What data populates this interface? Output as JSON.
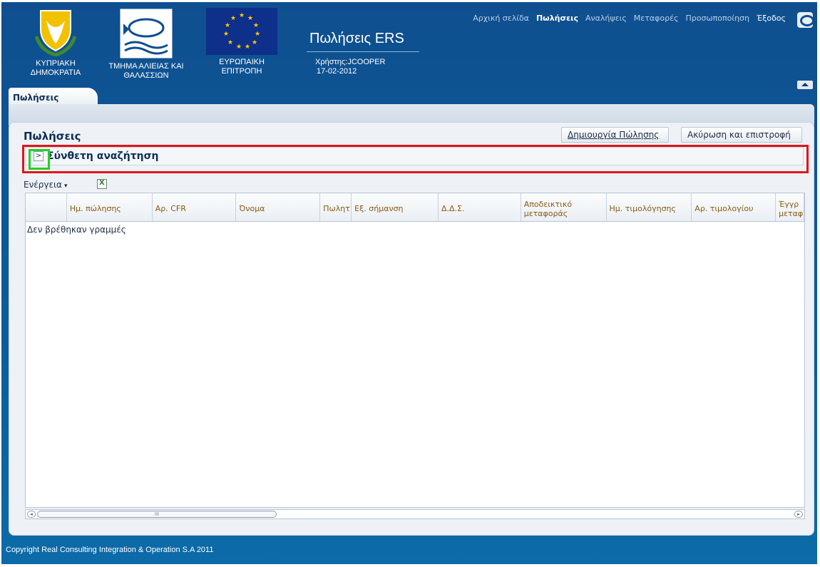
{
  "header": {
    "logos": [
      {
        "caption_line1": "ΚΥΠΡΙΑΚΗ",
        "caption_line2": "ΔΗΜΟΚΡΑΤΙΑ"
      },
      {
        "caption_line1": "ΤΜΗΜΑ ΑΛΙΕΙΑΣ ΚΑΙ",
        "caption_line2": "ΘΑΛΑΣΣΙΩΝ"
      },
      {
        "caption_line1": "ΕΥΡΩΠΑΙΚΗ",
        "caption_line2": "ΕΠΙΤΡΟΠΗ"
      }
    ],
    "app_title": "Πωλήσεις ERS",
    "user_label": "Χρήστης:JCOOPER",
    "date": "17-02-2012",
    "nav": [
      {
        "label": "Αρχική σελίδα"
      },
      {
        "label": "Πωλήσεις"
      },
      {
        "label": "Αναλήψεις"
      },
      {
        "label": "Μεταφορές"
      },
      {
        "label": "Προσωποποίηση"
      },
      {
        "label": "Έξοδος"
      }
    ],
    "active_nav": "Πωλήσεις",
    "tab_label": "Πωλήσεις"
  },
  "panel": {
    "title": "Πωλήσεις",
    "create_button": "Δημιουργία Πώλησης",
    "cancel_button": "Ακύρωση και επιστροφή",
    "advanced_search_label": "Σύνθετη αναζήτηση",
    "advanced_toggle_glyph": ">",
    "actions_label": "Ενέργεια",
    "actions_caret": "▾"
  },
  "grid": {
    "columns": [
      {
        "label": ""
      },
      {
        "label": "Ημ. πώλησης"
      },
      {
        "label": "Αρ. CFR"
      },
      {
        "label": "Όνομα"
      },
      {
        "label": "Πωλητ"
      },
      {
        "label": "Εξ. σήμανση"
      },
      {
        "label": "Δ.Δ.Σ."
      },
      {
        "label": "Αποδεικτικό μεταφοράς"
      },
      {
        "label": "Ημ. τιμολόγησης"
      },
      {
        "label": "Αρ. τιμολογίου"
      },
      {
        "label": "Έγγρ μεταφ"
      }
    ],
    "empty_message": "Δεν βρέθηκαν γραμμές",
    "scroll_thumb_glyph": "III",
    "scroll_left_glyph": "◂",
    "scroll_right_glyph": "▸"
  },
  "footer": {
    "copyright": "Copyright Real Consulting Integration & Operation S.A 2011"
  },
  "colors": {
    "header_bg": "#0f4f8f",
    "highlight_red": "#e2141a",
    "highlight_green": "#22d122",
    "column_header_text": "#8a5a10"
  }
}
